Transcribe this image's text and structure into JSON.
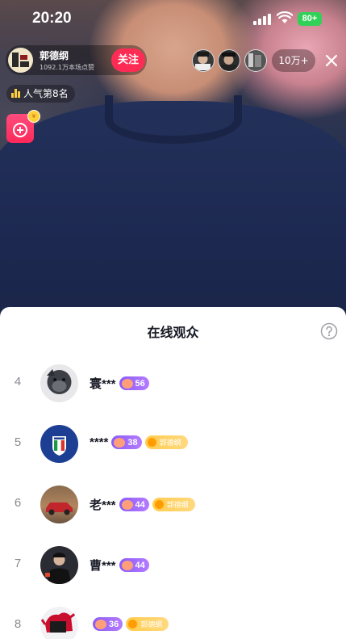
{
  "status_bar": {
    "time": "20:20",
    "battery": "80+"
  },
  "host": {
    "name": "郭德纲",
    "likes": "1092.1万本场点赞",
    "follow_label": "关注"
  },
  "viewers": {
    "count": "10万+"
  },
  "rank_badge": "人气第8名",
  "sheet": {
    "title": "在线观众",
    "rows": [
      {
        "rank": "4",
        "name": "寰***",
        "level": "56",
        "fan_badge": ""
      },
      {
        "rank": "5",
        "name": "****",
        "level": "38",
        "fan_badge": "郭德纲"
      },
      {
        "rank": "6",
        "name": "老***",
        "level": "44",
        "fan_badge": "郭德纲"
      },
      {
        "rank": "7",
        "name": "曹***",
        "level": "44",
        "fan_badge": ""
      },
      {
        "rank": "8",
        "name": "",
        "level": "36",
        "fan_badge": "郭德纲"
      }
    ]
  },
  "colors": {
    "follow": "#fe2c55",
    "level_badge": "#8a5cf6",
    "fan_badge": "#ffcc4d",
    "battery": "#31d158"
  }
}
